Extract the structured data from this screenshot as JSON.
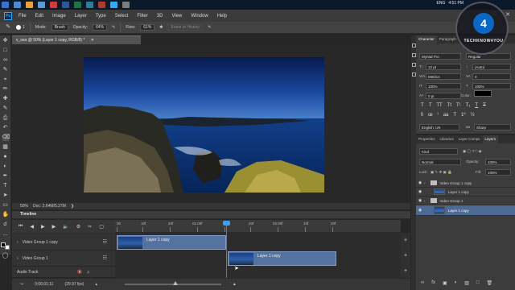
{
  "taskbar": {
    "icon_colors": [
      "#3b6fd1",
      "#4a89dc",
      "#e5a03a",
      "#5b9bd5",
      "#d13b3b",
      "#2b579a",
      "#217346",
      "#2d7d9a",
      "#b03a2e",
      "#31a8ff",
      "#7d7d7d"
    ],
    "time": "4:51 PM",
    "language": "ENG"
  },
  "menubar": {
    "app_logo": "Ps",
    "items": [
      "File",
      "Edit",
      "Image",
      "Layer",
      "Type",
      "Select",
      "Filter",
      "3D",
      "View",
      "Window",
      "Help"
    ]
  },
  "options": {
    "brush_size": "1",
    "mode_label": "Mode:",
    "mode_value": "Brush",
    "opacity_label": "Opacity:",
    "opacity_value": "64%",
    "flow_label": "Flow:",
    "flow_value": "61%",
    "erase_history": "Erase to History"
  },
  "document": {
    "tab_title": "v_sea @ 50% (Layer 1 copy, RGB/8) *",
    "zoom": "50%",
    "doc_info": "Doc: 2.64M/5.27M"
  },
  "timeline": {
    "title": "Timeline",
    "ruler_labels": [
      "00",
      "10f",
      "20f",
      "01:00f",
      "10f",
      "20f",
      "02:00f",
      "10f",
      "20f"
    ],
    "tracks": [
      {
        "name": "Video Group 1 copy",
        "clip_label": "Layer 1 copy"
      },
      {
        "name": "Video Group 1",
        "clip_label": "Layer 1 copy"
      }
    ],
    "audio_track": "Audio Track",
    "timecode": "0;00;01;11",
    "fps": "(29.97 fps)"
  },
  "character": {
    "tabs": [
      "Character",
      "Paragraph"
    ],
    "font_family": "Myriad Pro",
    "font_style": "Regular",
    "font_size": "12 pt",
    "leading": "(Auto)",
    "kerning": "Metrics",
    "tracking": "0",
    "vertical_scale": "100%",
    "horizontal_scale": "100%",
    "baseline_shift": "0 pt",
    "color_label": "Color:",
    "language": "English: UK",
    "antialias": "Sharp"
  },
  "layers": {
    "tabs": [
      "Properties",
      "Libraries",
      "Layer Comps",
      "Layers"
    ],
    "filter_kind": "Kind",
    "blend_mode": "Normal",
    "opacity_label": "Opacity:",
    "opacity": "100%",
    "lock_label": "Lock:",
    "fill_label": "Fill:",
    "fill": "100%",
    "rows": [
      {
        "type": "group",
        "name": "Video Group 1 copy"
      },
      {
        "type": "layer",
        "name": "Layer 1 copy"
      },
      {
        "type": "group",
        "name": "Video Group 1"
      },
      {
        "type": "layer",
        "name": "Layer 1 copy",
        "selected": true
      }
    ]
  },
  "watermark": {
    "badge": "4",
    "text": "TECHKNOW4YOU"
  }
}
